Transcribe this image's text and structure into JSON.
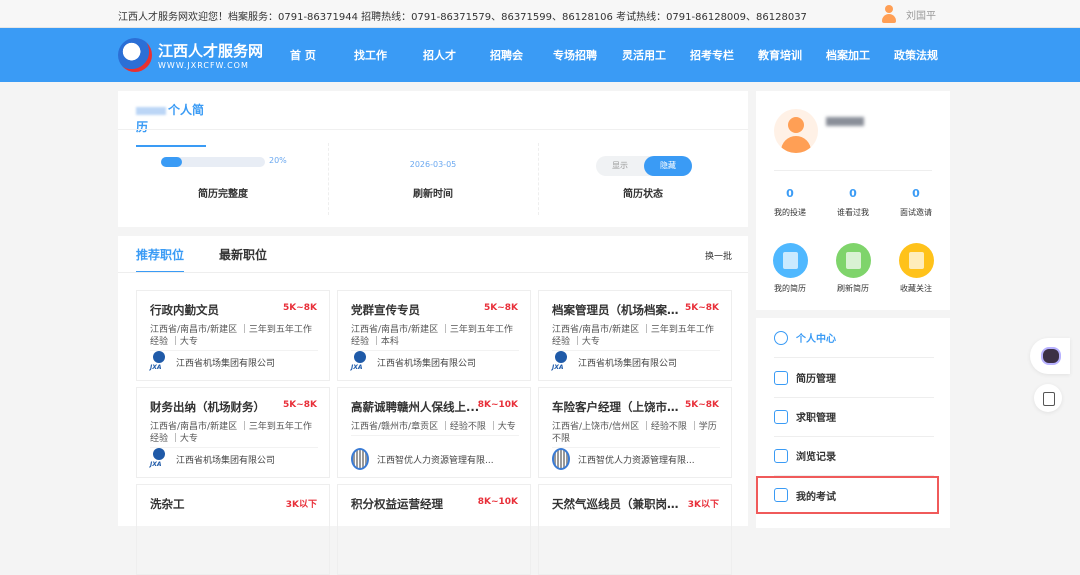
{
  "topbar": {
    "notice": "江西人才服务网欢迎您！档案服务：0791-86371944 招聘热线：0791-86371579、86371599、86128106 考试热线：0791-86128009、86128037",
    "username": "刘国平"
  },
  "nav": {
    "logo_title": "江西人才服务网",
    "logo_url": "WWW.JXRCFW.COM",
    "items": [
      "首 页",
      "找工作",
      "招人才",
      "招聘会",
      "专场招聘",
      "灵活用工",
      "招考专栏",
      "教育培训",
      "档案加工",
      "政策法规"
    ]
  },
  "resume": {
    "title": "个人简历",
    "completeness": 20,
    "completeness_label": "20%",
    "completeness_caption": "简历完整度",
    "refresh_date": "2026-03-05",
    "refresh_caption": "刷新时间",
    "status_show": "显示",
    "status_hide": "隐藏",
    "status_caption": "简历状态",
    "status_value": "隐藏"
  },
  "jobs": {
    "tabs": [
      "推荐职位",
      "最新职位"
    ],
    "refresh": "换一批",
    "items": [
      {
        "title": "行政内勤文员",
        "salary": "5K~8K",
        "info": "江西省/南昌市/新建区 ｜三年到五年工作经验 ｜大专",
        "company": "江西省机场集团有限公司",
        "logo": "jxa"
      },
      {
        "title": "党群宣传专员",
        "salary": "5K~8K",
        "info": "江西省/南昌市/新建区 ｜三年到五年工作经验 ｜本科",
        "company": "江西省机场集团有限公司",
        "logo": "jxa"
      },
      {
        "title": "档案管理员（机场档案 / ...",
        "salary": "5K~8K",
        "info": "江西省/南昌市/新建区 ｜三年到五年工作经验 ｜大专",
        "company": "江西省机场集团有限公司",
        "logo": "jxa"
      },
      {
        "title": "财务出纳（机场财务）",
        "salary": "5K~8K",
        "info": "江西省/南昌市/新建区 ｜三年到五年工作经验 ｜大专",
        "company": "江西省机场集团有限公司",
        "logo": "jxa"
      },
      {
        "title": "高薪诚聘赣州人保线上...",
        "salary": "8K~10K",
        "info": "江西省/赣州市/章贡区 ｜经验不限 ｜大专",
        "company": "江西智优人力资源管理有限...",
        "logo": "zy"
      },
      {
        "title": "车险客户经理（上饶市地...",
        "salary": "5K~8K",
        "info": "江西省/上饶市/信州区 ｜经验不限 ｜学历不限",
        "company": "江西智优人力资源管理有限...",
        "logo": "zy"
      },
      {
        "title": "洗杂工",
        "salary": "3K以下",
        "info": "",
        "company": "",
        "logo": ""
      },
      {
        "title": "积分权益运营经理",
        "salary": "8K~10K",
        "info": "",
        "company": "",
        "logo": ""
      },
      {
        "title": "天然气巡线员（兼职岗位...",
        "salary": "3K以下",
        "info": "",
        "company": "",
        "logo": ""
      }
    ]
  },
  "profile": {
    "stats": [
      {
        "value": "0",
        "label": "我的投递"
      },
      {
        "value": "0",
        "label": "谁看过我"
      },
      {
        "value": "0",
        "label": "面试邀请"
      }
    ],
    "actions": [
      {
        "label": "我的简历",
        "color": "#4fb8ff"
      },
      {
        "label": "刷新简历",
        "color": "#7fd46b"
      },
      {
        "label": "收藏关注",
        "color": "#ffc21a"
      }
    ]
  },
  "menu": {
    "items": [
      "个人中心",
      "简历管理",
      "求职管理",
      "浏览记录",
      "我的考试"
    ]
  }
}
